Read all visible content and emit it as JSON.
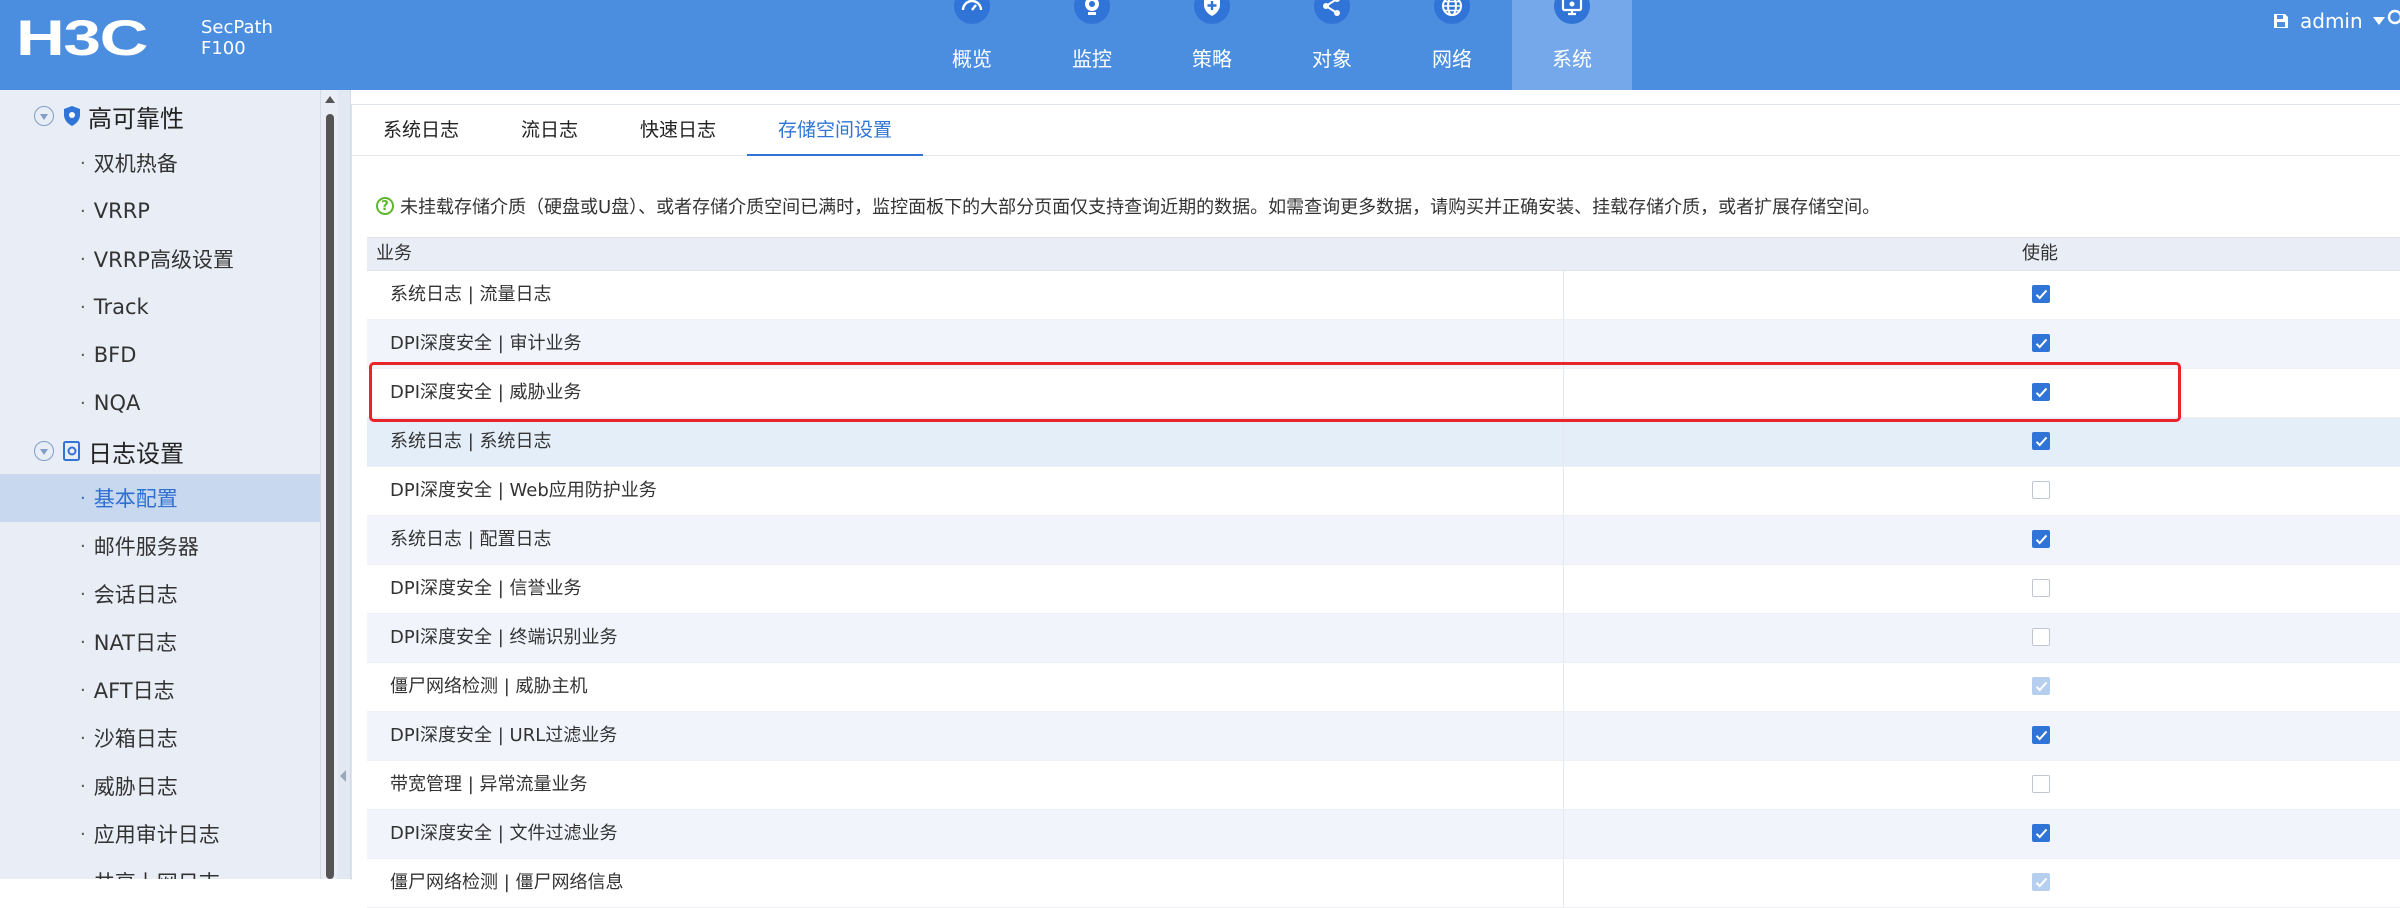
{
  "header": {
    "logo": "H3C",
    "product_line1": "SecPath",
    "product_line2": "F100",
    "nav": [
      {
        "label": "概览",
        "icon": "dashboard-icon"
      },
      {
        "label": "监控",
        "icon": "monitor-camera-icon"
      },
      {
        "label": "策略",
        "icon": "shield-plus-icon"
      },
      {
        "label": "对象",
        "icon": "share-nodes-icon"
      },
      {
        "label": "网络",
        "icon": "globe-icon"
      },
      {
        "label": "系统",
        "icon": "system-display-icon",
        "active": true
      }
    ],
    "user": "admin"
  },
  "sidebar": {
    "groups": [
      {
        "label": "高可靠性",
        "icon": "shield-icon",
        "items": [
          "双机热备",
          "VRRP",
          "VRRP高级设置",
          "Track",
          "BFD",
          "NQA"
        ]
      },
      {
        "label": "日志设置",
        "icon": "log-settings-icon",
        "items": [
          "基本配置",
          "邮件服务器",
          "会话日志",
          "NAT日志",
          "AFT日志",
          "沙箱日志",
          "威胁日志",
          "应用审计日志",
          "共享上网日志"
        ]
      }
    ],
    "selected": "基本配置"
  },
  "tabs": [
    {
      "label": "系统日志"
    },
    {
      "label": "流日志"
    },
    {
      "label": "快速日志"
    },
    {
      "label": "存储空间设置",
      "active": true
    }
  ],
  "notice": "未挂载存储介质（硬盘或U盘）、或者存储介质空间已满时，监控面板下的大部分页面仅支持查询近期的数据。如需查询更多数据，请购买并正确安装、挂载存储介质，或者扩展存储空间。",
  "table": {
    "columns": [
      "业务",
      "使能"
    ],
    "rows": [
      {
        "name": "系统日志 | 流量日志",
        "state": "checked"
      },
      {
        "name": "DPI深度安全 | 审计业务",
        "state": "checked"
      },
      {
        "name": "DPI深度安全 | 威胁业务",
        "state": "checked"
      },
      {
        "name": "系统日志 | 系统日志",
        "state": "checked"
      },
      {
        "name": "DPI深度安全 | Web应用防护业务",
        "state": "unchecked"
      },
      {
        "name": "系统日志 | 配置日志",
        "state": "checked"
      },
      {
        "name": "DPI深度安全 | 信誉业务",
        "state": "unchecked"
      },
      {
        "name": "DPI深度安全 | 终端识别业务",
        "state": "unchecked"
      },
      {
        "name": "僵尸网络检测 | 威胁主机",
        "state": "checked-disabled"
      },
      {
        "name": "DPI深度安全 | URL过滤业务",
        "state": "checked"
      },
      {
        "name": "带宽管理 | 异常流量业务",
        "state": "unchecked"
      },
      {
        "name": "DPI深度安全 | 文件过滤业务",
        "state": "checked"
      },
      {
        "name": "僵尸网络检测 | 僵尸网络信息",
        "state": "checked-disabled"
      }
    ]
  },
  "colors": {
    "topbar": "#4b8ee0",
    "accent": "#2f74d6",
    "highlight": "#e8252a"
  }
}
